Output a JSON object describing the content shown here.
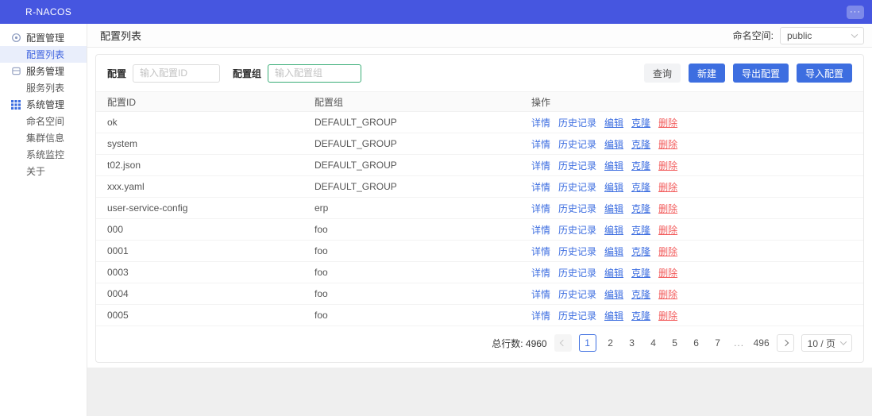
{
  "topbar": {
    "brand": "R-NACOS",
    "menu_button": "···"
  },
  "sidebar": {
    "items": [
      {
        "label": "配置管理"
      },
      {
        "label": "配置列表"
      },
      {
        "label": "服务管理"
      },
      {
        "label": "服务列表"
      },
      {
        "label": "系统管理"
      },
      {
        "label": "命名空间"
      },
      {
        "label": "集群信息"
      },
      {
        "label": "系统监控"
      },
      {
        "label": "关于"
      }
    ]
  },
  "page_header": {
    "title": "配置列表",
    "namespace_label": "命名空间:",
    "namespace_value": "public"
  },
  "filter": {
    "config_label": "配置",
    "config_placeholder": "输入配置ID",
    "group_label": "配置组",
    "group_placeholder": "输入配置组"
  },
  "toolbar": {
    "query": "查询",
    "create": "新建",
    "export_config": "导出配置",
    "import_config": "导入配置"
  },
  "table": {
    "columns": [
      "配置ID",
      "配置组",
      "操作"
    ],
    "actions": {
      "detail": "详情",
      "history": "历史记录",
      "edit": "编辑",
      "clone": "克隆",
      "delete": "删除"
    },
    "rows": [
      {
        "id": "ok",
        "group": "DEFAULT_GROUP"
      },
      {
        "id": "system",
        "group": "DEFAULT_GROUP"
      },
      {
        "id": "t02.json",
        "group": "DEFAULT_GROUP"
      },
      {
        "id": "xxx.yaml",
        "group": "DEFAULT_GROUP"
      },
      {
        "id": "user-service-config",
        "group": "erp"
      },
      {
        "id": "000",
        "group": "foo"
      },
      {
        "id": "0001",
        "group": "foo"
      },
      {
        "id": "0003",
        "group": "foo"
      },
      {
        "id": "0004",
        "group": "foo"
      },
      {
        "id": "0005",
        "group": "foo"
      }
    ]
  },
  "pagination": {
    "total_label": "总行数:",
    "total": "4960",
    "pages": [
      "1",
      "2",
      "3",
      "4",
      "5",
      "6",
      "7",
      "...",
      "496"
    ],
    "current_page": "1",
    "page_size": "10 / 页"
  },
  "colors": {
    "header_bg": "#4656E0",
    "accent": "#3D6EE0",
    "danger": "#F25D5D",
    "focus_border": "#3AAD77",
    "sidebar_active_bg": "#E9EEFB"
  }
}
